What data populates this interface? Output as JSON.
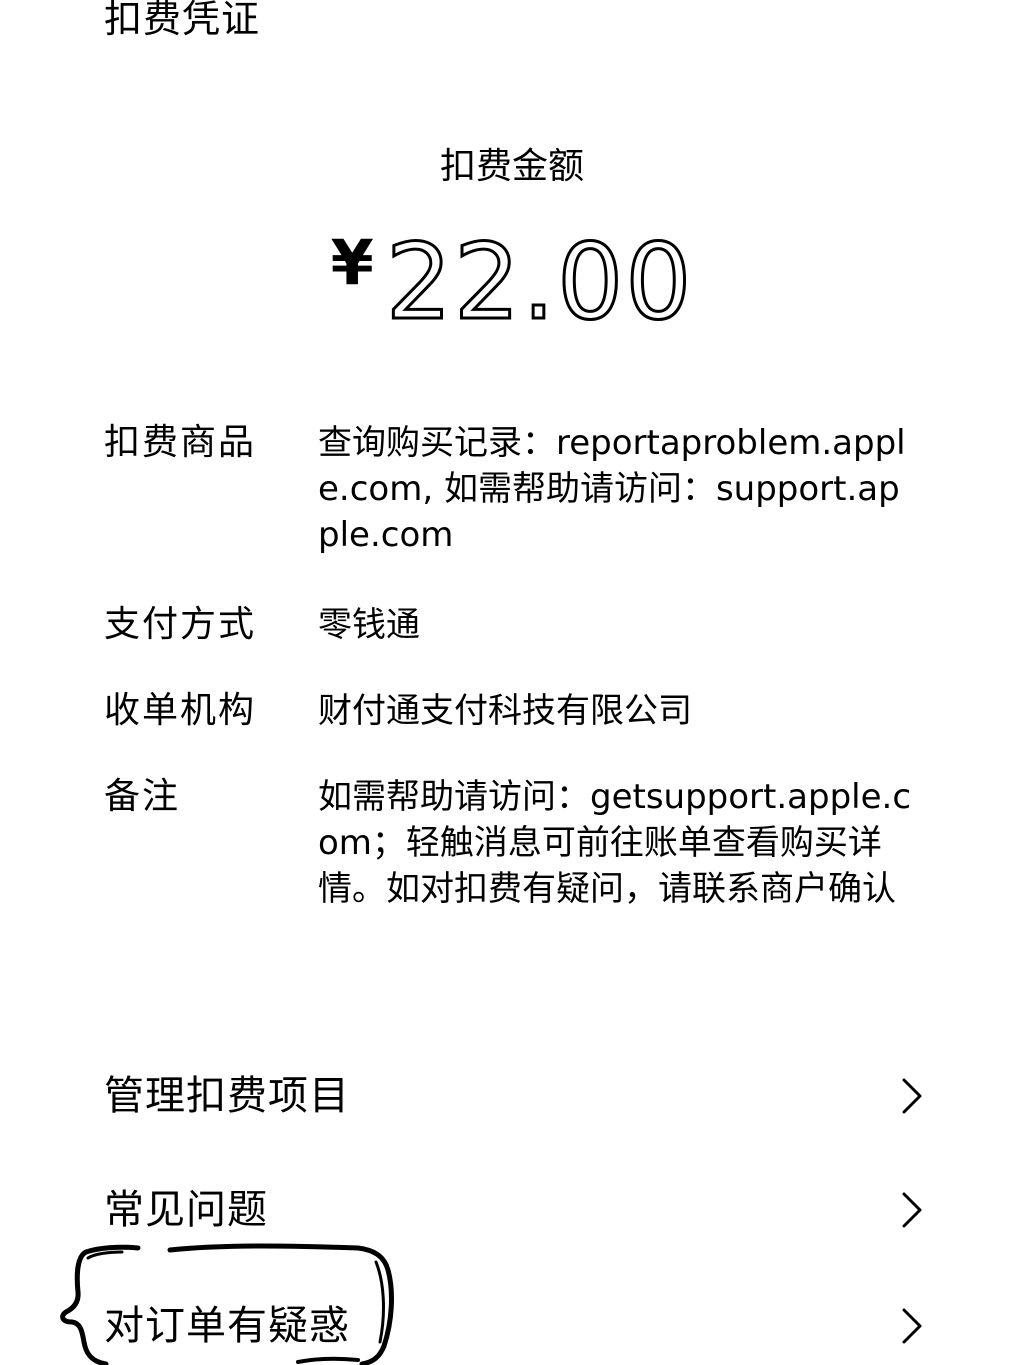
{
  "header": {
    "title": "扣费凭证"
  },
  "amount": {
    "label": "扣费金额",
    "currency": "¥",
    "value": "22.00"
  },
  "details": [
    {
      "key": "扣费商品",
      "value": "查询购买记录：reportaproblem.apple.com, 如需帮助请访问：support.apple.com"
    },
    {
      "key": "支付方式",
      "value": "零钱通"
    },
    {
      "key": "收单机构",
      "value": "财付通支付科技有限公司"
    },
    {
      "key": "备注",
      "value": "如需帮助请访问：getsupport.apple.com；轻触消息可前往账单查看购买详情。如对扣费有疑问，请联系商户确认"
    }
  ],
  "menu": [
    {
      "label": "管理扣费项目",
      "icon": "chevron-right-icon"
    },
    {
      "label": "常见问题",
      "icon": "chevron-right-icon"
    },
    {
      "label": "对订单有疑惑",
      "icon": "chevron-right-icon"
    }
  ]
}
